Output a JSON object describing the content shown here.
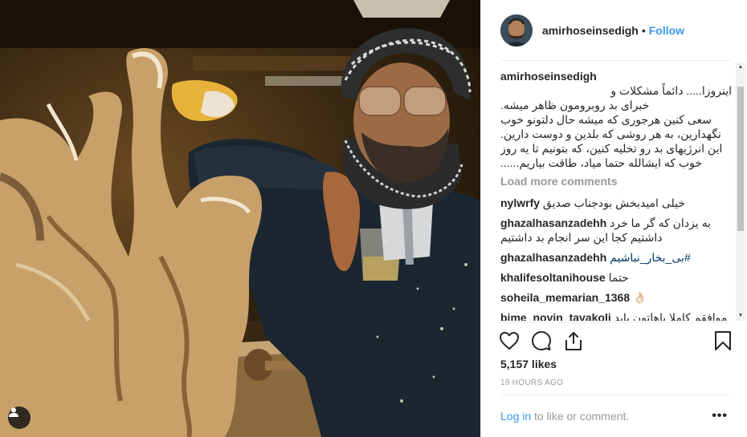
{
  "post": {
    "username": "amirhoseinsedigh",
    "separator": "•",
    "follow_label": "Follow",
    "caption": {
      "lines": [
        "اینروزا..... دائماً مشکلات و",
        "خبرای بد روبرومون ظاهر میشه.",
        "سعی کنین هرجوری که میشه حال دلتونو خوب",
        "نگهدارین، به هر روشی که بلدین و دوست دارین.",
        "این انرژیهای بد رو تخلیه کنین، که بتونیم تا یه روز",
        "خوب که ایشالله حتما میاد، طاقت بیاریم......"
      ]
    },
    "load_more": "Load more comments",
    "comments": [
      {
        "user": "nylwrfy",
        "text": "خیلی امیدبخش بودجناب صدیق"
      },
      {
        "user": "ghazalhasanzadehh",
        "text": "به یزدان که گر ما خرد داشتیم کجا این سر انجام بد داشتیم"
      },
      {
        "user": "ghazalhasanzadehh",
        "text": "#بی_بخار_نباشیم"
      },
      {
        "user": "khalifesoltanihouse",
        "text": "حتما"
      },
      {
        "user": "soheila_memarian_1368",
        "text": "👌🏻"
      },
      {
        "user": "bime_novin_tavakoli",
        "text": "موافقم کاملا باهاتون باید خودمون به گوال بزنیم"
      }
    ],
    "likes": "5,157 likes",
    "timestamp": "19 HOURS AGO",
    "login_link": "Log in",
    "login_suffix": " to like or comment.",
    "more_options": "•••"
  },
  "icons": {
    "like": "heart-icon",
    "comment": "comment-icon",
    "share": "share-icon",
    "save": "bookmark-icon",
    "user_tag": "user-tag-icon"
  },
  "colors": {
    "link_blue": "#3897f0",
    "text": "#262626",
    "muted": "#999999",
    "hashtag": "#003569"
  }
}
